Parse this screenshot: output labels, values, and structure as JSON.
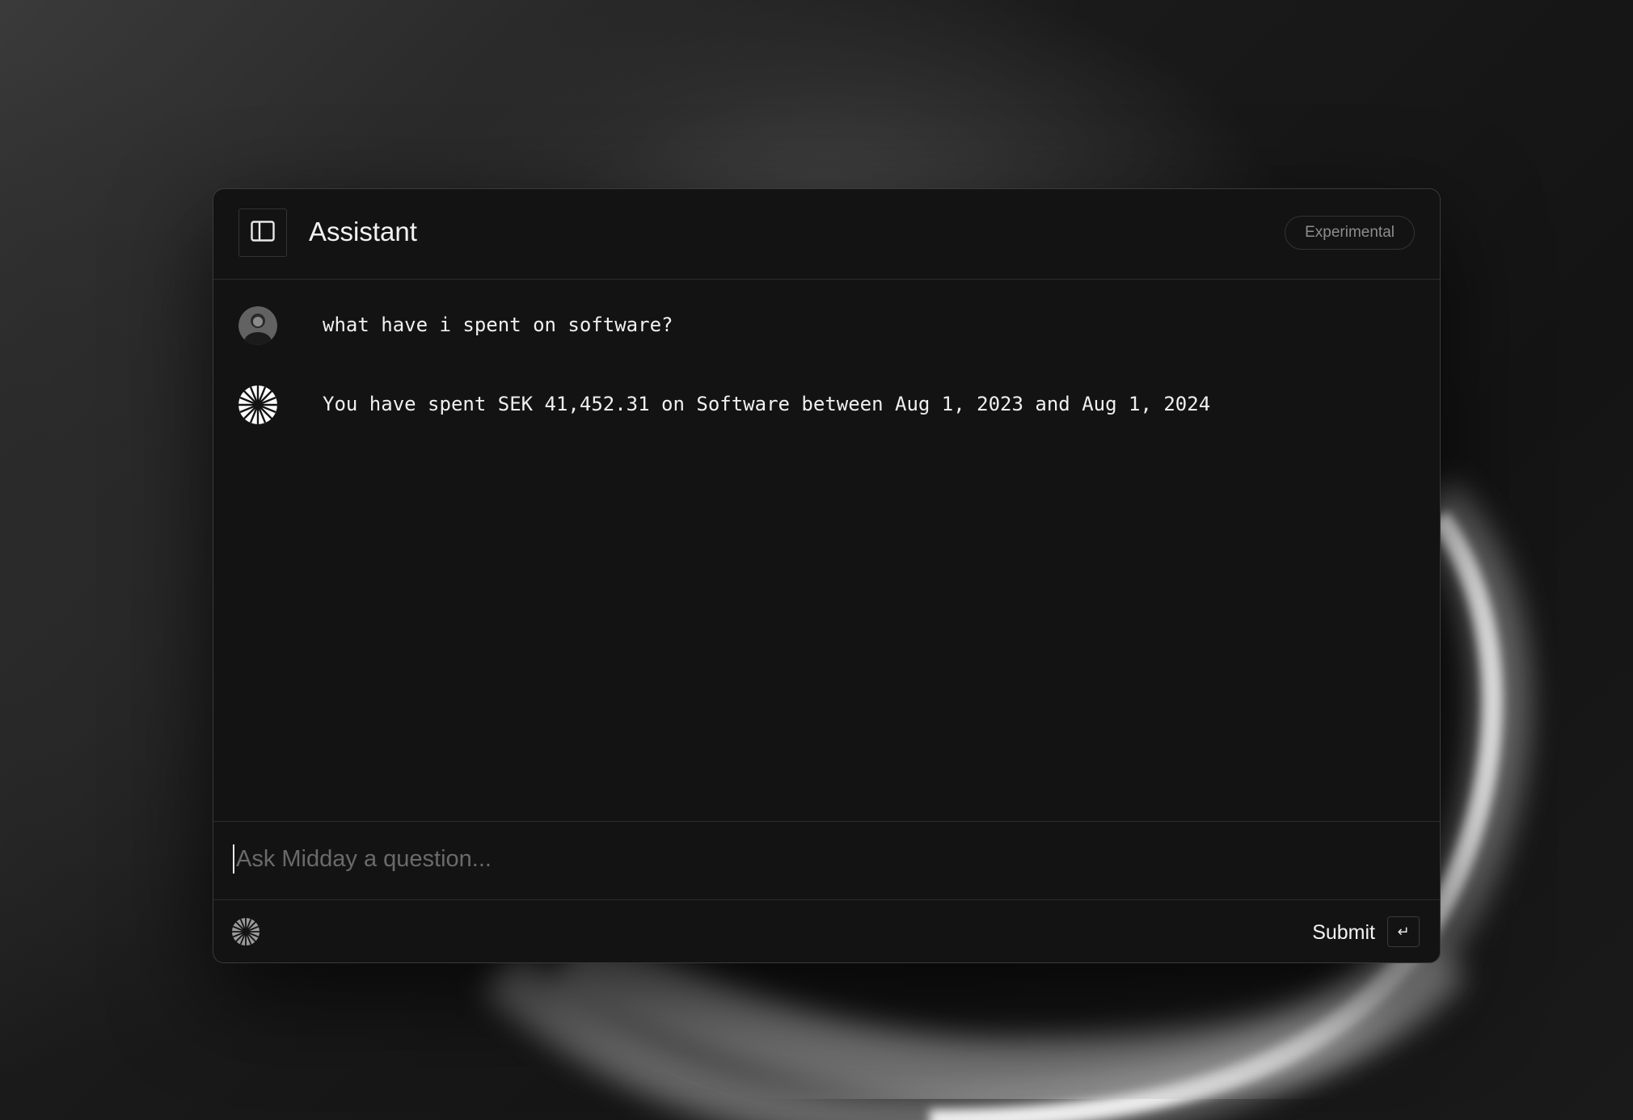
{
  "window": {
    "title": "Assistant",
    "badge": "Experimental"
  },
  "messages": [
    {
      "role": "user",
      "avatar_icon": "user-photo-avatar",
      "text": "what have i spent on software?"
    },
    {
      "role": "assistant",
      "avatar_icon": "midday-logo-icon",
      "text": "You have spent SEK 41,452.31 on Software between Aug 1, 2023 and Aug 1, 2024"
    }
  ],
  "composer": {
    "value": "",
    "placeholder": "Ask Midday a question...",
    "submit_label": "Submit",
    "submit_key": "↵"
  },
  "icons": {
    "sidebar_toggle": "sidebar-toggle-icon",
    "footer": "midday-logo-icon"
  },
  "colors": {
    "window_bg": "#131313",
    "border": "#2c2c2c",
    "text": "#f0f0f0",
    "muted": "#8d8d8d"
  }
}
